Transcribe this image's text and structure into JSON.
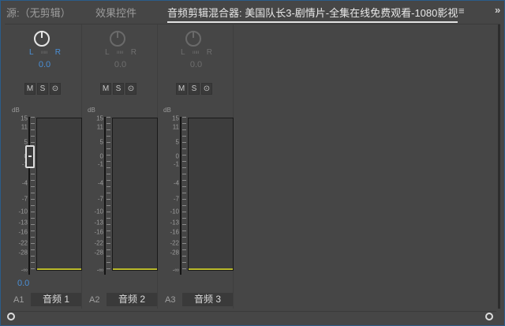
{
  "tabs": [
    {
      "label": "源:（无剪辑）"
    },
    {
      "label": "效果控件"
    },
    {
      "label": "音频剪辑混合器: 美国队长3-剧情片-全集在线免费观看-1080影视"
    }
  ],
  "menu_icon": "hamburger-icon",
  "more_icon": "chevron-double-right-icon",
  "scale_labels": [
    "dB",
    "15",
    "11",
    "5",
    "0",
    "-1",
    "-4",
    "-7",
    "-10",
    "-13",
    "-16",
    "-22",
    "-28",
    "-∞"
  ],
  "tracks": [
    {
      "id": "A1",
      "name": "音频 1",
      "pan_l": "L",
      "pan_r": "R",
      "pan_value": "0.0",
      "volume": "0.0",
      "mute": "M",
      "solo": "S",
      "record": "⊙",
      "active": true
    },
    {
      "id": "A2",
      "name": "音频 2",
      "pan_l": "L",
      "pan_r": "R",
      "pan_value": "0.0",
      "mute": "M",
      "solo": "S",
      "record": "⊙",
      "active": false
    },
    {
      "id": "A3",
      "name": "音频 3",
      "pan_l": "L",
      "pan_r": "R",
      "pan_value": "0.0",
      "mute": "M",
      "solo": "S",
      "record": "⊙",
      "active": false
    }
  ],
  "colors": {
    "accent": "#4a8fd6",
    "meter": "#b9b92a"
  }
}
